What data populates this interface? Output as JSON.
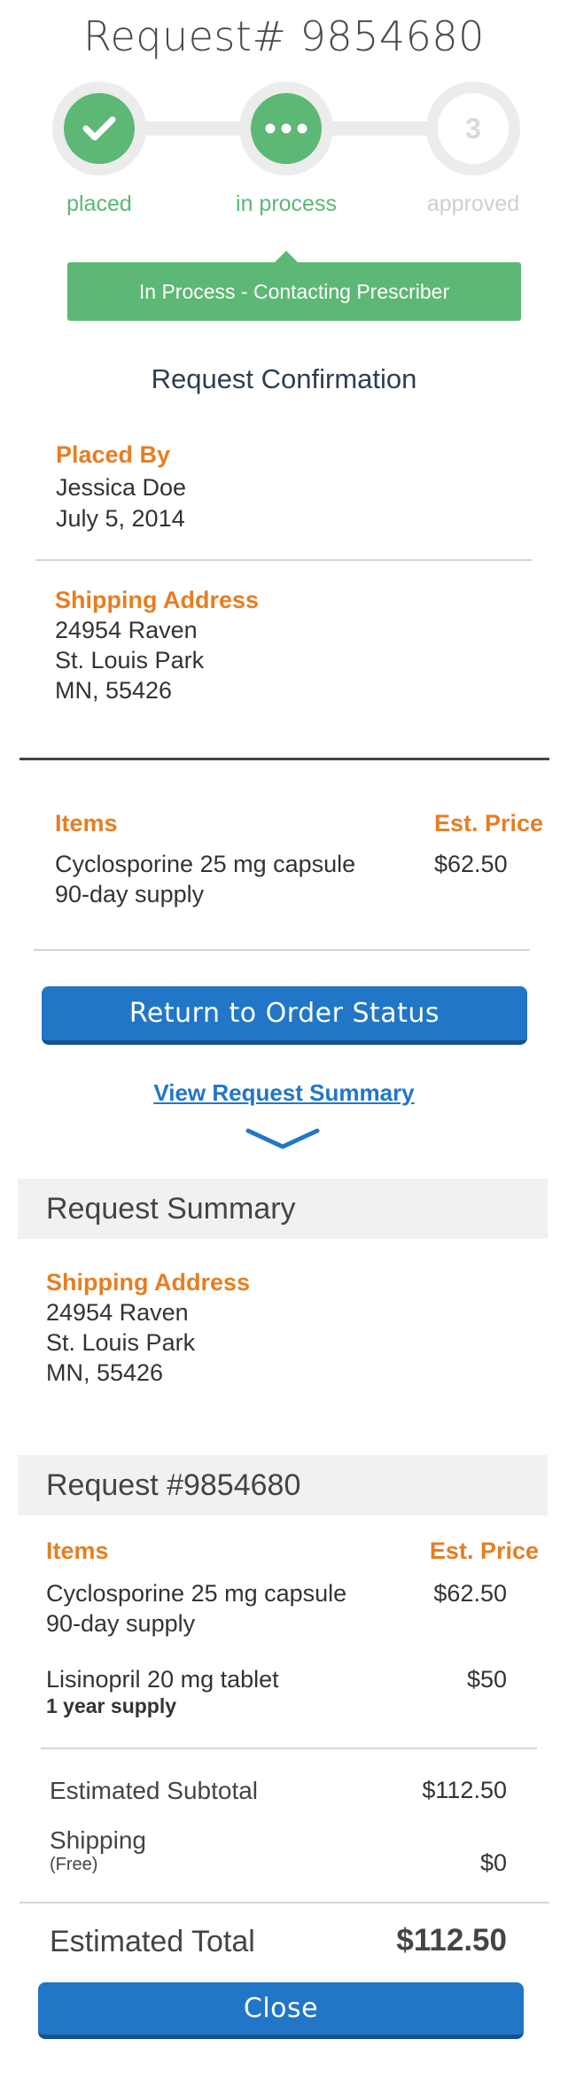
{
  "header": {
    "title": "Request# 9854680"
  },
  "progress": {
    "steps": [
      {
        "label": "placed",
        "state": "done",
        "icon": "check-icon"
      },
      {
        "label": "in process",
        "state": "done",
        "icon": "ellipsis-icon"
      },
      {
        "label": "approved",
        "state": "todo",
        "number": "3"
      }
    ]
  },
  "status_banner": {
    "text": "In Process - Contacting Prescriber",
    "color": "#5cb874"
  },
  "confirmation": {
    "heading": "Request Confirmation",
    "placed_by": {
      "label": "Placed By",
      "name": "Jessica Doe",
      "date": "July 5, 2014"
    },
    "shipping": {
      "label": "Shipping Address",
      "line1": "24954 Raven",
      "line2": "St. Louis Park",
      "line3": "MN, 55426"
    },
    "items_header": "Items",
    "price_header": "Est. Price",
    "items": [
      {
        "name": "Cyclosporine 25 mg capsule",
        "detail": "90-day supply",
        "price": "$62.50"
      }
    ]
  },
  "actions": {
    "return_label": "Return to Order Status",
    "view_summary_label": "View Request Summary",
    "close_label": "Close"
  },
  "summary": {
    "heading": "Request Summary",
    "shipping": {
      "label": "Shipping Address",
      "line1": "24954 Raven",
      "line2": "St. Louis Park",
      "line3": "MN, 55426"
    },
    "request_heading": "Request #9854680",
    "items_header": "Items",
    "price_header": "Est. Price",
    "items": [
      {
        "name": "Cyclosporine 25 mg capsule",
        "detail": "90-day supply",
        "price": "$62.50"
      },
      {
        "name": "Lisinopril 20 mg tablet",
        "detail": "1 year supply",
        "price": "$50"
      }
    ],
    "subtotal_label": "Estimated Subtotal",
    "subtotal_value": "$112.50",
    "shipping_label": "Shipping",
    "shipping_note": "(Free)",
    "shipping_value": "$0",
    "total_label": "Estimated Total",
    "total_value": "$112.50"
  },
  "colors": {
    "accent": "#2176c7",
    "success": "#5cb874",
    "label": "#e67e22"
  }
}
